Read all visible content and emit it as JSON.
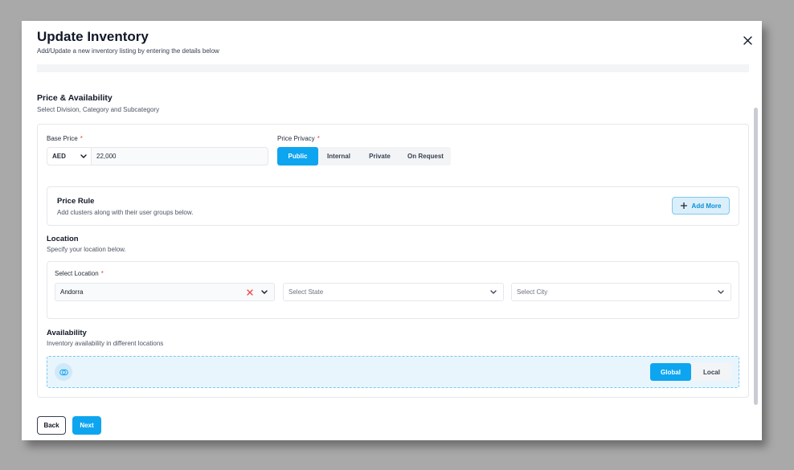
{
  "modal": {
    "title": "Update Inventory",
    "subtitle": "Add/Update a new inventory listing by entering the details below"
  },
  "section": {
    "title": "Price & Availability",
    "subtitle": "Select Division, Category and Subcategory"
  },
  "base_price": {
    "label": "Base Price",
    "required_mark": "*",
    "currency": "AED",
    "value": "22,000"
  },
  "price_privacy": {
    "label": "Price Privacy",
    "required_mark": "*",
    "options": [
      "Public",
      "Internal",
      "Private",
      "On Request"
    ],
    "selected": "Public"
  },
  "price_rule": {
    "title": "Price Rule",
    "subtitle": "Add clusters along with their user groups below.",
    "add_more_label": "Add More"
  },
  "location": {
    "title": "Location",
    "subtitle": "Specify your location below.",
    "select_label": "Select Location",
    "required_mark": "*",
    "country_value": "Andorra",
    "state_placeholder": "Select State",
    "city_placeholder": "Select City"
  },
  "availability": {
    "title": "Availability",
    "subtitle": "Inventory availability in different locations",
    "options": [
      "Global",
      "Local"
    ],
    "selected": "Global"
  },
  "footer": {
    "back_label": "Back",
    "next_label": "Next"
  },
  "colors": {
    "accent": "#0ea5f0",
    "required": "#ef4444"
  }
}
